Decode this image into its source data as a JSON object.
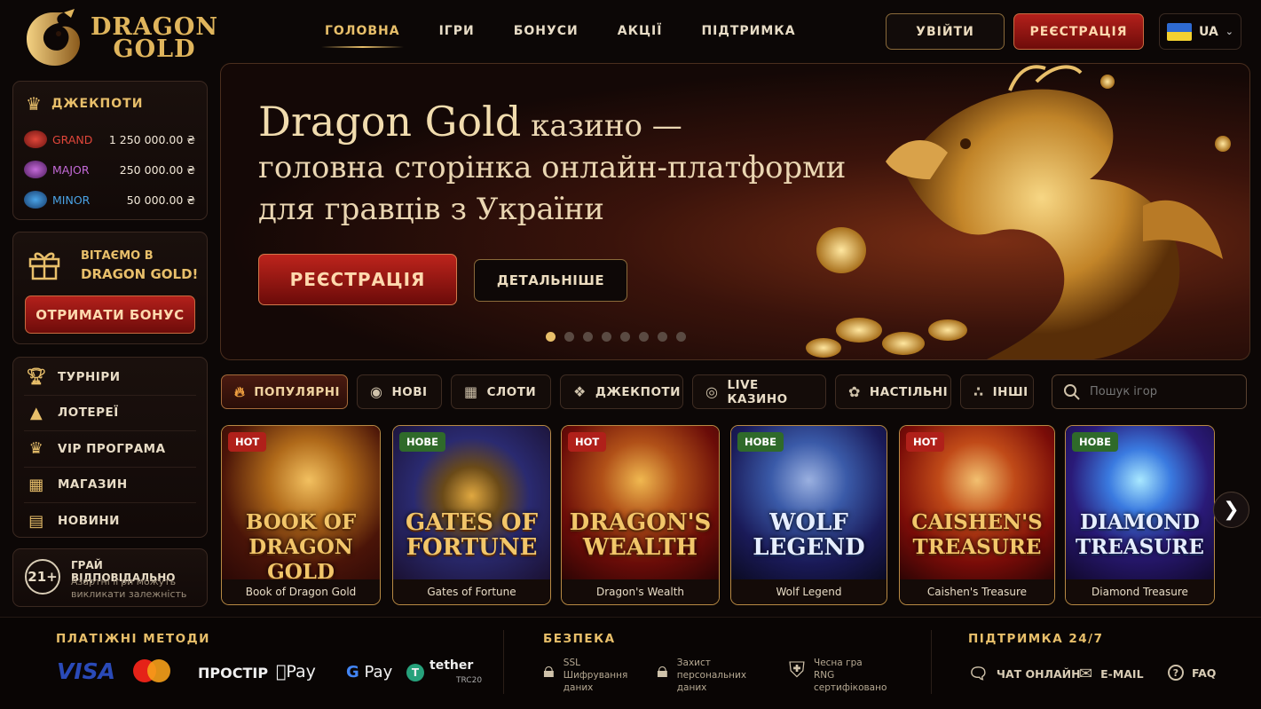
{
  "brand": {
    "line1": "DRAGON",
    "line2": "GOLD"
  },
  "nav": [
    {
      "label": "ГОЛОВНА",
      "active": true
    },
    {
      "label": "ІГРИ"
    },
    {
      "label": "БОНУСИ"
    },
    {
      "label": "АКЦІЇ"
    },
    {
      "label": "ПІДТРИМКА"
    }
  ],
  "header": {
    "login": "УВІЙТИ",
    "register": "РЕЄСТРАЦІЯ",
    "lang": "UA"
  },
  "jackpots": {
    "title": "ДЖЕКПОТИ",
    "items": [
      {
        "name": "GRAND",
        "value": "1 250 000.00 ₴",
        "color": "#e0463a"
      },
      {
        "name": "MAJOR",
        "value": "250 000.00 ₴",
        "color": "#c46ad8"
      },
      {
        "name": "MINOR",
        "value": "50 000.00 ₴",
        "color": "#4aa3e6"
      }
    ]
  },
  "welcome": {
    "line1": "ВІТАЄМО В",
    "line2": "DRAGON GOLD!",
    "button": "ОТРИМАТИ БОНУС"
  },
  "menu": [
    {
      "label": "ТУРНІРИ",
      "icon": "trophy-icon"
    },
    {
      "label": "ЛОТЕРЕЇ",
      "icon": "lottery-icon"
    },
    {
      "label": "VIP ПРОГРАМА",
      "icon": "crown-icon"
    },
    {
      "label": "МАГАЗИН",
      "icon": "shop-basket-icon"
    },
    {
      "label": "НОВИНИ",
      "icon": "news-icon"
    }
  ],
  "responsible": {
    "age": "21+",
    "title": "ГРАЙ ВІДПОВІДАЛЬНО",
    "text": "Азартні ігри можуть викликати залежність"
  },
  "hero": {
    "title_big": "Dragon Gold",
    "title_rest": " казино —",
    "line2": "головна сторінка онлайн-платформи",
    "line3": "для гравців з України",
    "register": "РЕЄСТРАЦІЯ",
    "more": "ДЕТАЛЬНІШЕ",
    "slides": 8,
    "active_slide": 0
  },
  "filters": [
    {
      "label": "ПОПУЛЯРНІ",
      "icon": "fire-icon",
      "active": true
    },
    {
      "label": "НОВІ",
      "icon": "new-icon"
    },
    {
      "label": "СЛОТИ",
      "icon": "slots-icon"
    },
    {
      "label": "ДЖЕКПОТИ",
      "icon": "jackpot-icon"
    },
    {
      "label": "LIVE КАЗИНО",
      "icon": "live-icon"
    },
    {
      "label": "НАСТІЛЬНІ",
      "icon": "table-games-icon"
    },
    {
      "label": "ІНШІ",
      "icon": "other-icon"
    }
  ],
  "search": {
    "placeholder": "Пошук ігор"
  },
  "games": [
    {
      "title_art": "BOOK OF DRAGON GOLD",
      "name": "Book of Dragon Gold",
      "tag": "HOT"
    },
    {
      "title_art": "GATES OF FORTUNE",
      "name": "Gates of Fortune",
      "tag": "НОВЕ"
    },
    {
      "title_art": "DRAGON'S WEALTH",
      "name": "Dragon's Wealth",
      "tag": "HOT"
    },
    {
      "title_art": "WOLF LEGEND",
      "name": "Wolf Legend",
      "tag": "НОВЕ"
    },
    {
      "title_art": "CAISHEN'S TREASURE",
      "name": "Caishen's Treasure",
      "tag": "HOT"
    },
    {
      "title_art": "DIAMOND TREASURE",
      "name": "Diamond Treasure",
      "tag": "НОВЕ"
    }
  ],
  "footer": {
    "payments_title": "ПЛАТІЖНІ МЕТОДИ",
    "payments": {
      "visa": "VISA",
      "prostir": "ПРОСТІР",
      "applepay": "Pay",
      "gpay": "Pay",
      "tether": "tether",
      "tether_sub": "TRC20"
    },
    "security_title": "БЕЗПЕКА",
    "security": [
      {
        "l1": "SSL",
        "l2": "Шифрування",
        "l3": "даних"
      },
      {
        "l1": "Захист",
        "l2": "персональних",
        "l3": "даних"
      },
      {
        "l1": "Чесна гра",
        "l2": "RNG",
        "l3": "сертифіковано"
      }
    ],
    "support_title": "ПІДТРИМКА 24/7",
    "support": [
      {
        "label": "ЧАТ ОНЛАЙН"
      },
      {
        "label": "E-MAIL"
      },
      {
        "label": "FAQ"
      }
    ]
  }
}
